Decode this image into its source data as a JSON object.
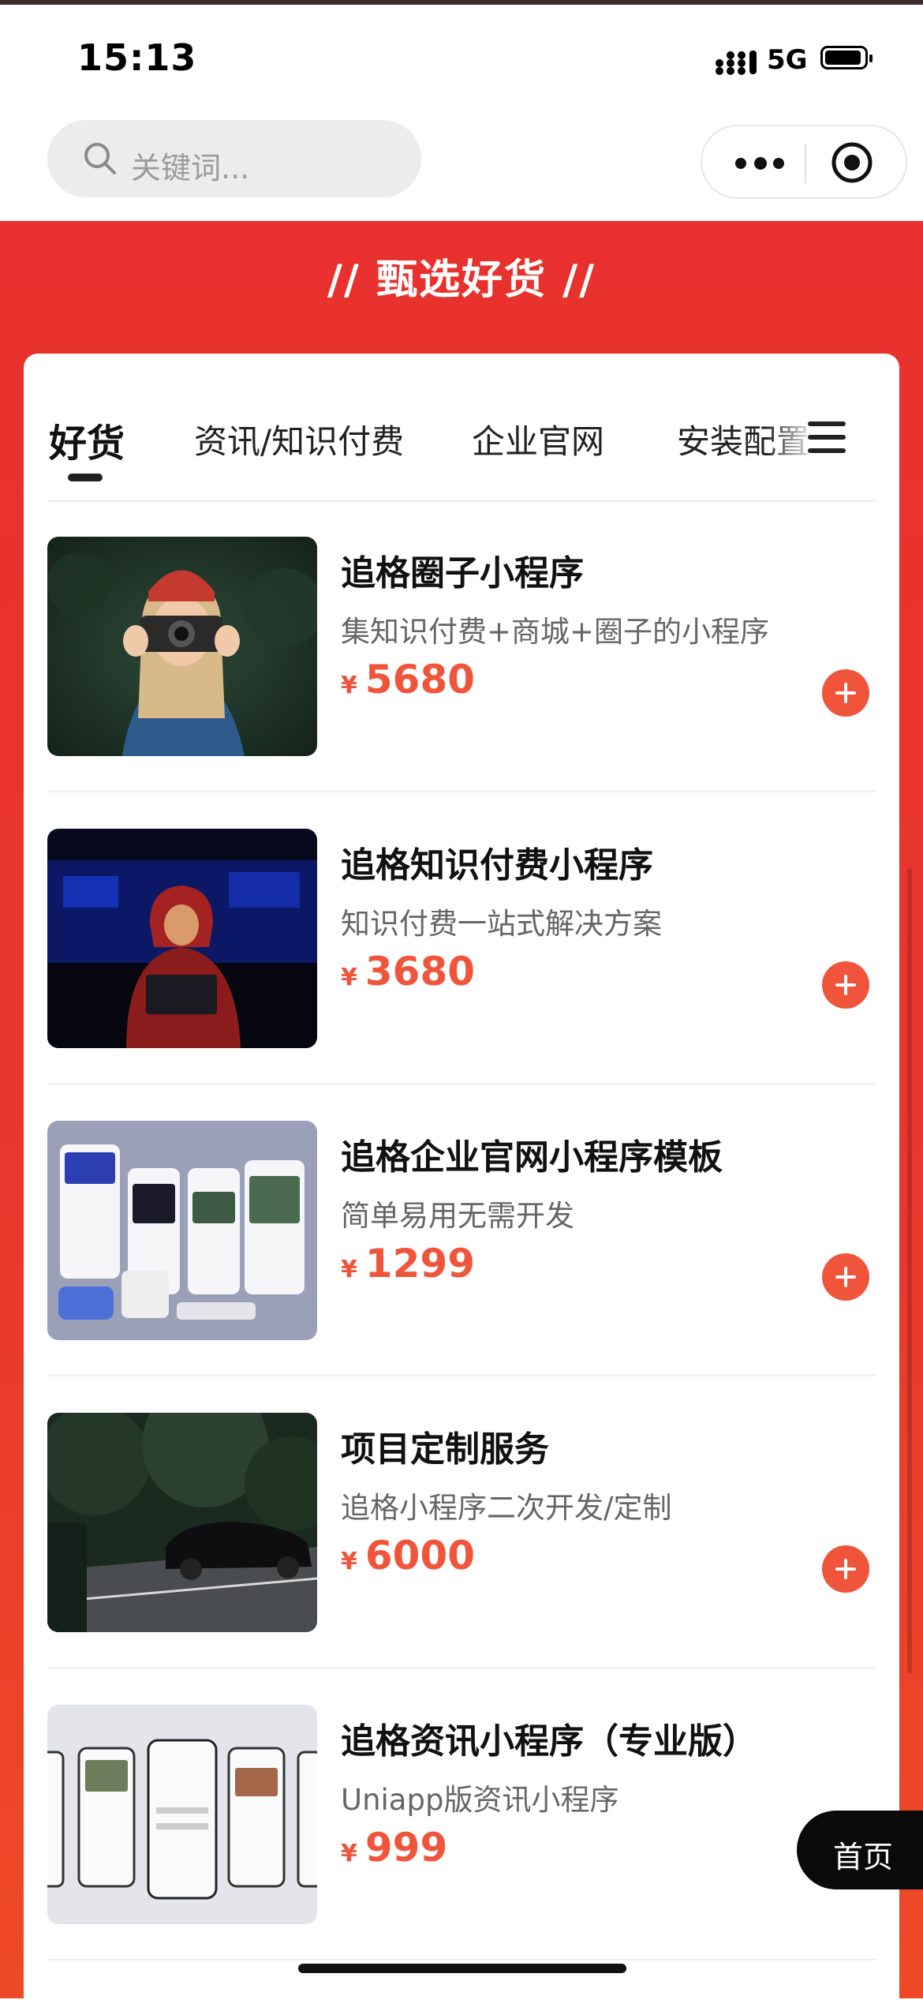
{
  "status_bar": {
    "time": "15:13",
    "network": "5G"
  },
  "search": {
    "placeholder": "关键词..."
  },
  "banner": {
    "title": "// 甄选好货 //"
  },
  "tabs": [
    {
      "label": "好货",
      "active": true
    },
    {
      "label": "资讯/知识付费",
      "active": false
    },
    {
      "label": "企业官网",
      "active": false
    },
    {
      "label": "安装配置",
      "active": false
    }
  ],
  "currency_symbol": "¥",
  "products": [
    {
      "title": "追格圈子小程序",
      "desc": "集知识付费+商城+圈子的小程序",
      "price": "5680"
    },
    {
      "title": "追格知识付费小程序",
      "desc": "知识付费一站式解决方案",
      "price": "3680"
    },
    {
      "title": "追格企业官网小程序模板",
      "desc": "简单易用无需开发",
      "price": "1299"
    },
    {
      "title": "项目定制服务",
      "desc": "追格小程序二次开发/定制",
      "price": "6000"
    },
    {
      "title": "追格资讯小程序（专业版）",
      "desc": "Uniapp版资讯小程序",
      "price": "999"
    }
  ],
  "home_button": {
    "label": "首页"
  },
  "colors": {
    "brand_red": "#e8312e",
    "price": "#f0553b"
  }
}
